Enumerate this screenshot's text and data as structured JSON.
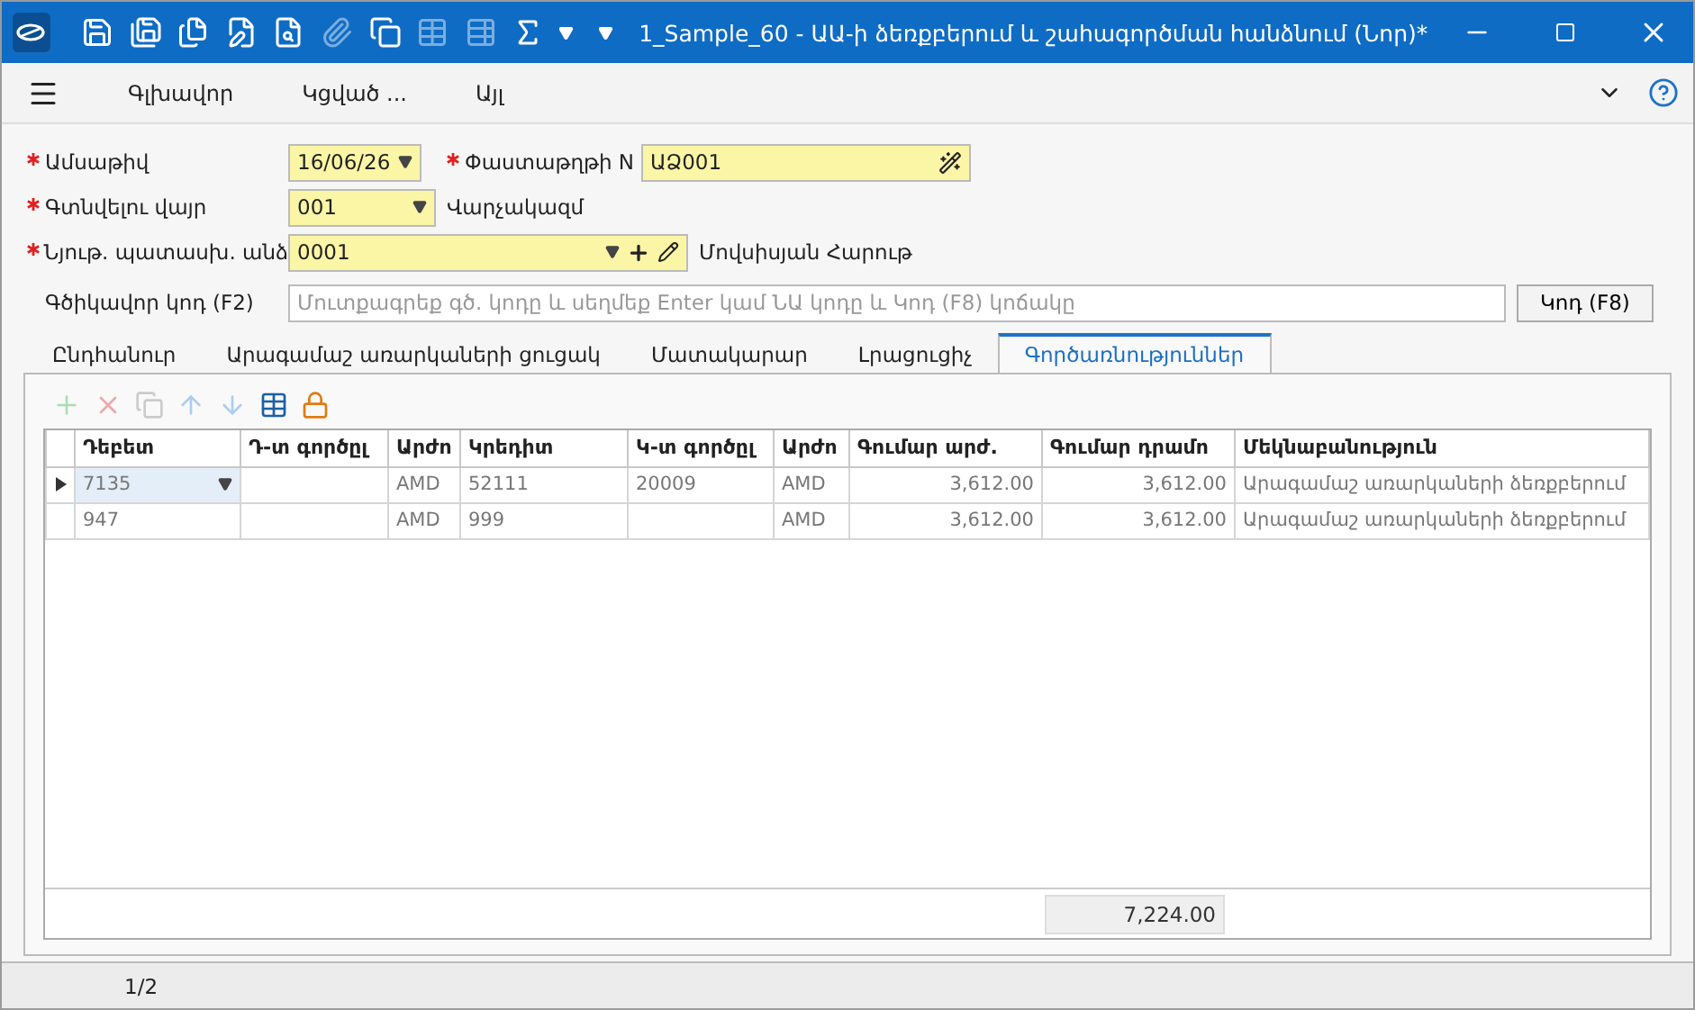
{
  "window": {
    "title": "1_Sample_60 - ԱԱ-ի ձեռքբերում և շահագործման հանձնում (Նոր)*"
  },
  "title_toolbar": [
    {
      "kind": "save",
      "disabled": false
    },
    {
      "kind": "save-check",
      "disabled": false
    },
    {
      "kind": "save-copy",
      "disabled": false
    },
    {
      "kind": "pdf-edit",
      "disabled": false
    },
    {
      "kind": "preview",
      "disabled": false
    },
    {
      "kind": "attach",
      "disabled": true
    },
    {
      "kind": "copy-out",
      "disabled": false
    },
    {
      "kind": "table",
      "disabled": true
    },
    {
      "kind": "table-link",
      "disabled": true
    },
    {
      "kind": "sum-table",
      "disabled": false
    }
  ],
  "menu": [
    {
      "label": "Գլխավոր"
    },
    {
      "label": "Կցված ..."
    },
    {
      "label": "Այլ"
    }
  ],
  "form": {
    "fields": [
      {
        "label": "Ամսաթիվ",
        "required": true,
        "value": "16/06/26",
        "kind": "dropdown"
      },
      {
        "label": "Փաստաթղթի N",
        "required": true,
        "value": "ԱՁ001",
        "kind": "wand"
      },
      {
        "label": "Գտնվելու վայր",
        "required": true,
        "value": "001",
        "kind": "dropdown",
        "note": "Վարչակազմ"
      },
      {
        "label": "Նյութ. պատասխ. անձ",
        "required": true,
        "value": "0001",
        "kind": "lookup",
        "note": "Մովսիսյան Հարութ"
      },
      {
        "label": "Գծիկավոր կոդ (F2)",
        "required": false,
        "placeholder": "Մուտքագրեք գծ. կոդը և սեղմեք Enter կամ ՆԱ կոդը և Կոդ (F8) կոճակը",
        "button": "Կոդ (F8)",
        "kind": "barcode"
      }
    ]
  },
  "tabs": [
    {
      "label": "Ընդհանուր",
      "selected": false
    },
    {
      "label": "Արագամաշ առարկաների ցուցակ",
      "selected": false
    },
    {
      "label": "Մատակարար",
      "selected": false
    },
    {
      "label": "Լրացուցիչ",
      "selected": false
    },
    {
      "label": "Գործառնություններ",
      "selected": true
    }
  ],
  "grid_toolbar": [
    {
      "kind": "add",
      "disabled": true
    },
    {
      "kind": "delete",
      "disabled": true
    },
    {
      "kind": "copy",
      "disabled": true
    },
    {
      "kind": "up",
      "disabled": true
    },
    {
      "kind": "down",
      "disabled": true
    },
    {
      "kind": "table-delete",
      "disabled": false
    },
    {
      "kind": "lock",
      "disabled": false
    }
  ],
  "table": {
    "columns": [
      "Դեբետ",
      "Դ-տ գործըլ",
      "Արժո",
      "Կրեդիտ",
      "Կ-տ գործըլ",
      "Արժո",
      "Գումար արժ.",
      "Գումար դրամո",
      "Մեկնաբանություն"
    ],
    "rows": [
      {
        "selected": true,
        "cells": [
          "7135",
          "",
          "AMD",
          "52111",
          "20009",
          "AMD",
          "3,612.00",
          "3,612.00",
          "Արագամաշ առարկաների ձեռքբերում"
        ]
      },
      {
        "selected": false,
        "cells": [
          "947",
          "",
          "AMD",
          "999",
          "",
          "AMD",
          "3,612.00",
          "3,612.00",
          "Արագամաշ առարկաների ձեռքբերում"
        ]
      }
    ],
    "total": "7,224.00"
  },
  "status_bar": {
    "page": "1/2"
  }
}
